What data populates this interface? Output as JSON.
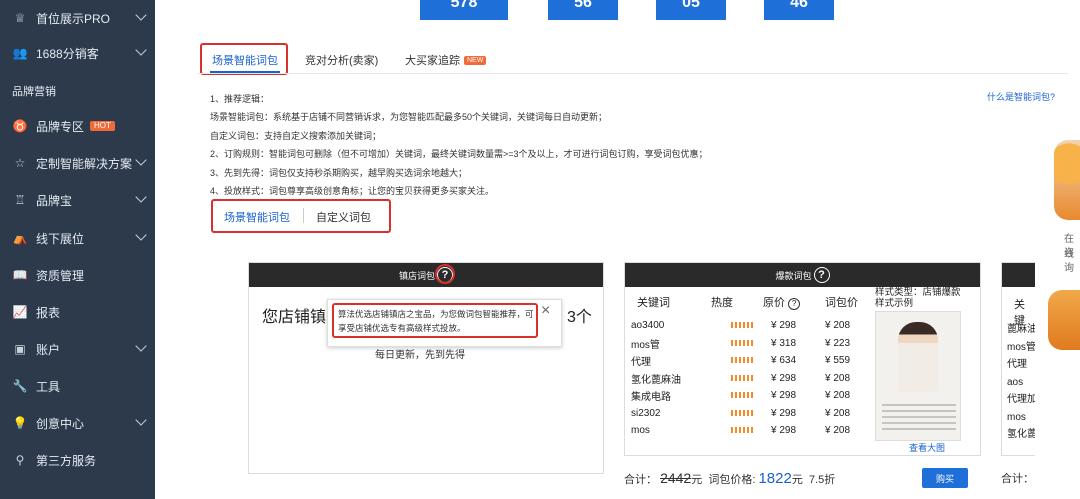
{
  "sidebar": {
    "items": [
      {
        "label": "首位展示PRO",
        "icon": "crown-icon",
        "glyph": "♕",
        "has_chevron": true
      },
      {
        "label": "1688分销客",
        "icon": "users-icon",
        "glyph": "👥",
        "has_chevron": true
      },
      {
        "label": "品牌营销",
        "section": true
      },
      {
        "label": "品牌专区",
        "icon": "award-icon",
        "glyph": "♉",
        "badge": "HOT"
      },
      {
        "label": "定制智能解决方案",
        "icon": "star-icon",
        "glyph": "☆",
        "has_chevron": true
      },
      {
        "label": "品牌宝",
        "icon": "trophy-icon",
        "glyph": "♖",
        "has_chevron": true
      },
      {
        "label": "线下展位",
        "icon": "booth-icon",
        "glyph": "⛺",
        "has_chevron": true
      },
      {
        "label": "资质管理",
        "icon": "book-icon",
        "glyph": "📖"
      },
      {
        "label": "报表",
        "icon": "chart-icon",
        "glyph": "📈"
      },
      {
        "label": "账户",
        "icon": "account-icon",
        "glyph": "▣",
        "has_chevron": true
      },
      {
        "label": "工具",
        "icon": "wrench-icon",
        "glyph": "🔧"
      },
      {
        "label": "创意中心",
        "icon": "bulb-icon",
        "glyph": "💡",
        "has_chevron": true
      },
      {
        "label": "第三方服务",
        "icon": "service-icon",
        "glyph": "⚲"
      }
    ]
  },
  "countdown": [
    "578",
    "56",
    "05",
    "46"
  ],
  "tabs": [
    {
      "label": "场景智能词包",
      "active": true
    },
    {
      "label": "竞对分析(卖家)",
      "active": false
    },
    {
      "label": "大买家追踪",
      "active": false,
      "badge": "NEW"
    }
  ],
  "help_link": "什么是智能词包?",
  "rules": [
    "1、推荐逻辑：",
    "场景智能词包：系统基于店铺不同营销诉求，为您智能匹配最多50个关键词，关键词每日自动更新；",
    "自定义词包：支持自定义搜索添加关键词；",
    "2、订购规则：智能词包可删除（但不可增加）关键词，最终关键词数量需>=3个及以上，才可进行词包订购，享受词包优惠；",
    "3、先到先得：词包仅支持秒杀期购买，越早购买选词余地越大；",
    "4、投放样式：词包尊享高级创意角标；让您的宝贝获得更多买家关注。"
  ],
  "subtabs": [
    {
      "label": "场景智能词包",
      "active": true
    },
    {
      "label": "自定义词包",
      "active": false
    }
  ],
  "card1": {
    "title": "镇店词包",
    "body_left": "您店铺镇",
    "body_right": "3个",
    "sub": "每日更新，先到先得"
  },
  "tooltip": {
    "text": "算法优选店铺镇店之宝品，为您做词包智能推荐，可享受店铺优选专有高级样式投放。"
  },
  "card2": {
    "title": "爆款词包",
    "columns": [
      "关键词",
      "热度",
      "原价",
      "词包价"
    ],
    "rows": [
      {
        "kw": "ao3400",
        "orig": "¥ 298",
        "pack": "¥ 208"
      },
      {
        "kw": "mos管",
        "orig": "¥ 318",
        "pack": "¥ 223"
      },
      {
        "kw": "代理",
        "orig": "¥ 634",
        "pack": "¥ 559"
      },
      {
        "kw": "氢化蓖麻油",
        "orig": "¥ 298",
        "pack": "¥ 208"
      },
      {
        "kw": "集成电路",
        "orig": "¥ 298",
        "pack": "¥ 208"
      },
      {
        "kw": "si2302",
        "orig": "¥ 298",
        "pack": "¥ 208"
      },
      {
        "kw": "mos",
        "orig": "¥ 298",
        "pack": "¥ 208"
      }
    ],
    "style_label": "样式类型：店铺爆款",
    "style_example": "样式示例",
    "view_large": "查看大图",
    "total_label": "合计：",
    "total_orig": "2442",
    "yuan": "元",
    "pack_price_label": "词包价格:",
    "pack_price": "1822",
    "discount": "7.5折",
    "buy": "购买"
  },
  "card3": {
    "col": "关键",
    "rows": [
      "蓖麻油",
      "mos管",
      "代理",
      "aos",
      "代理加",
      "mos",
      "氢化蓖"
    ],
    "total_label": "合计："
  },
  "right_widget": {
    "line1": "在线",
    "line2": "咨询"
  },
  "colors": {
    "sidebar_bg": "#2c3a4c",
    "accent": "#1a62d1",
    "highlight_red": "#d9302b",
    "hot_orange": "#f06a3a"
  }
}
